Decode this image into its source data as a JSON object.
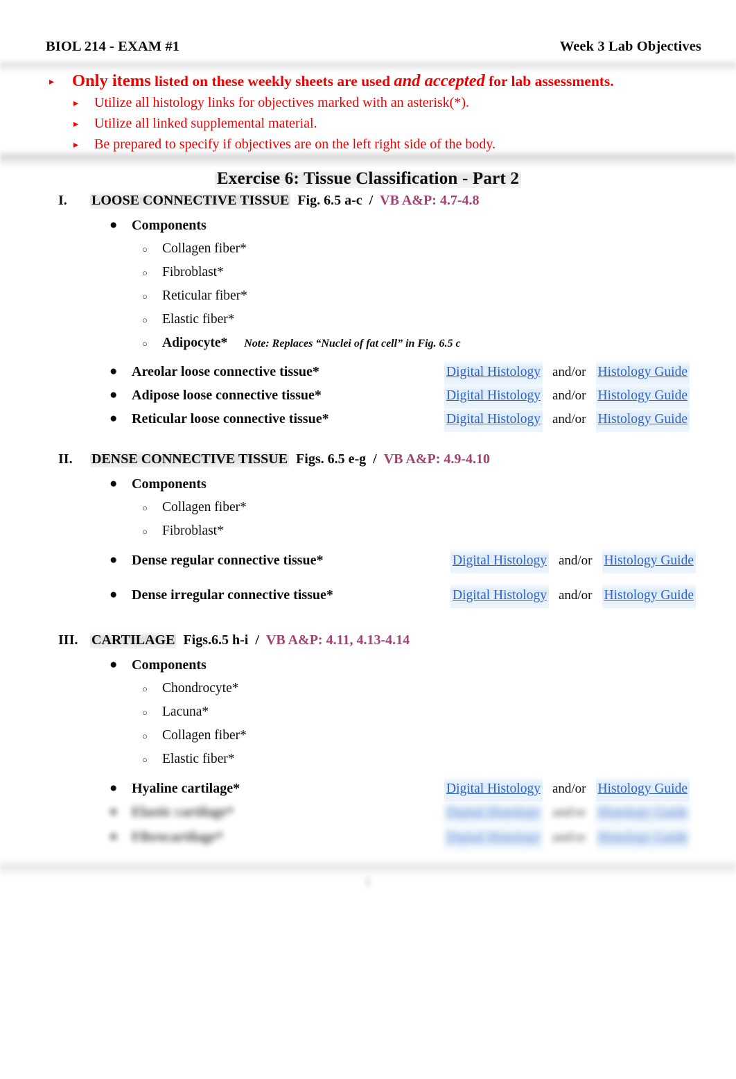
{
  "header": {
    "course_exam": "BIOL 214 - EXAM #1",
    "week_title": "Week 3 Lab Objectives"
  },
  "notice": {
    "main_bold": "Only items",
    "main_rest": " listed on these weekly sheets are used ",
    "main_italic": "and accepted",
    "main_tail": " for lab assessments.",
    "sub_items": [
      "Utilize all histology links for objectives marked with an asterisk(*).",
      "Utilize all linked supplemental material.",
      "Be prepared to specify if objectives are on the left right side of the body."
    ]
  },
  "exercise_title": "Exercise 6: Tissue Classification - Part 2",
  "link_labels": {
    "digital_histology": "Digital Histology",
    "and_or": "and/or",
    "histology_guide": "Histology Guide"
  },
  "sections": [
    {
      "numeral": "I.",
      "title": "LOOSE CONNECTIVE TISSUE",
      "figure": "Fig. 6.5 a-c",
      "separator": "/",
      "reference": "VB A&P: 4.7-4.8",
      "components_label": "Components",
      "components": [
        {
          "text": "Collagen fiber*",
          "note": ""
        },
        {
          "text": "Fibroblast*",
          "note": ""
        },
        {
          "text": "Reticular fiber*",
          "note": ""
        },
        {
          "text": "Elastic fiber*",
          "note": ""
        },
        {
          "text": "Adipocyte*",
          "note": "Note: Replaces “Nuclei of fat cell” in Fig. 6.5 c"
        }
      ],
      "items": [
        {
          "label": "Areolar loose connective tissue*",
          "blurred": false
        },
        {
          "label": "Adipose loose connective tissue*",
          "blurred": false
        },
        {
          "label": "Reticular loose connective tissue*",
          "blurred": false
        }
      ]
    },
    {
      "numeral": "II.",
      "title": "DENSE CONNECTIVE TISSUE",
      "figure": "Figs. 6.5 e-g",
      "separator": "/",
      "reference": "VB A&P: 4.9-4.10",
      "components_label": "Components",
      "components": [
        {
          "text": "Collagen fiber*",
          "note": ""
        },
        {
          "text": "Fibroblast*",
          "note": ""
        }
      ],
      "items": [
        {
          "label": "Dense regular connective tissue*",
          "blurred": false
        },
        {
          "label": "Dense irregular connective tissue*",
          "blurred": false
        }
      ]
    },
    {
      "numeral": "III.",
      "title": "CARTILAGE",
      "figure": "Figs.6.5 h-i",
      "separator": "/",
      "reference": "VB A&P: 4.11, 4.13-4.14",
      "components_label": "Components",
      "components": [
        {
          "text": "Chondrocyte*",
          "note": ""
        },
        {
          "text": "Lacuna*",
          "note": ""
        },
        {
          "text": "Collagen fiber*",
          "note": ""
        },
        {
          "text": "Elastic fiber*",
          "note": ""
        }
      ],
      "items": [
        {
          "label": "Hyaline cartilage*",
          "blurred": false
        },
        {
          "label": "Elastic cartilage*",
          "blurred": true
        },
        {
          "label": "Fibrocartilage*",
          "blurred": true
        }
      ]
    }
  ],
  "footer": {
    "page_mark": "1"
  },
  "colors": {
    "notice_red": "#ee0000",
    "reference_purple": "#a14372",
    "link_blue": "#2e62c8",
    "link_highlight": "#d6e8f8"
  }
}
